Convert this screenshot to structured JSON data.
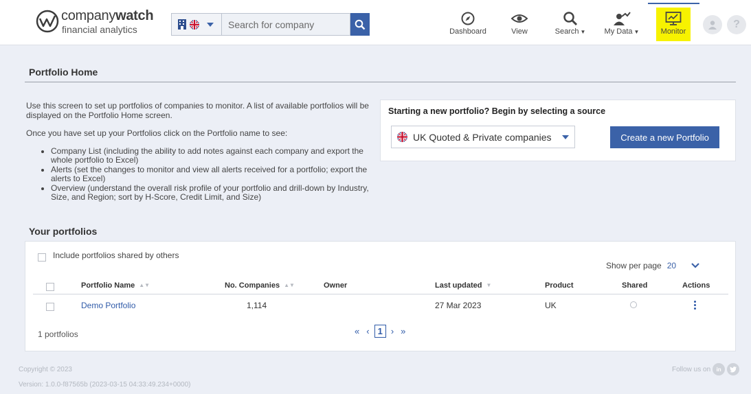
{
  "brand": {
    "name_part1": "company",
    "name_part2": "watch",
    "tagline": "financial analytics"
  },
  "search": {
    "placeholder": "Search for company",
    "country": "UK"
  },
  "nav": {
    "dashboard": "Dashboard",
    "view": "View",
    "search": "Search",
    "my_data": "My Data",
    "monitor": "Monitor"
  },
  "page": {
    "title": "Portfolio Home",
    "intro_p1": "Use this screen to set up portfolios of companies to monitor. A list of available portfolios will be displayed on the Portfolio Home screen.",
    "intro_p2": "Once you have set up your Portfolios click on the Portfolio name to see:",
    "bullets": [
      "Company List (including the ability to add notes against each company and export the whole portfolio to Excel)",
      "Alerts (set the changes to monitor and view all alerts received for a portfolio; export the alerts to Excel)",
      "Overview (understand the overall risk profile of your portfolio and drill-down by Industry, Size, and Region; sort by H-Score, Credit Limit, and Size)"
    ]
  },
  "new_portfolio": {
    "heading": "Starting a new portfolio? Begin by selecting a source",
    "source_selected": "UK Quoted & Private companies",
    "create_label": "Create a new Portfolio"
  },
  "portfolios": {
    "title": "Your portfolios",
    "include_shared_label": "Include portfolios shared by others",
    "show_per_page_label": "Show per page",
    "per_page_value": "20",
    "columns": {
      "name": "Portfolio Name",
      "companies": "No. Companies",
      "owner": "Owner",
      "updated": "Last updated",
      "product": "Product",
      "shared": "Shared",
      "actions": "Actions"
    },
    "rows": [
      {
        "name": "Demo Portfolio",
        "companies": "1,114",
        "owner": "",
        "updated": "27 Mar 2023",
        "product": "UK"
      }
    ],
    "count_text": "1 portfolios",
    "pager": {
      "first": "«",
      "prev": "‹",
      "current": "1",
      "next": "›",
      "last": "»"
    }
  },
  "footer": {
    "copyright": "Copyright © 2023",
    "version": "Version: 1.0.0-f87565b (2023-03-15 04:33:49.234+0000)",
    "follow": "Follow us on"
  },
  "colors": {
    "accent": "#3b62a8",
    "highlight": "#f7f200",
    "background": "#eceff6"
  }
}
